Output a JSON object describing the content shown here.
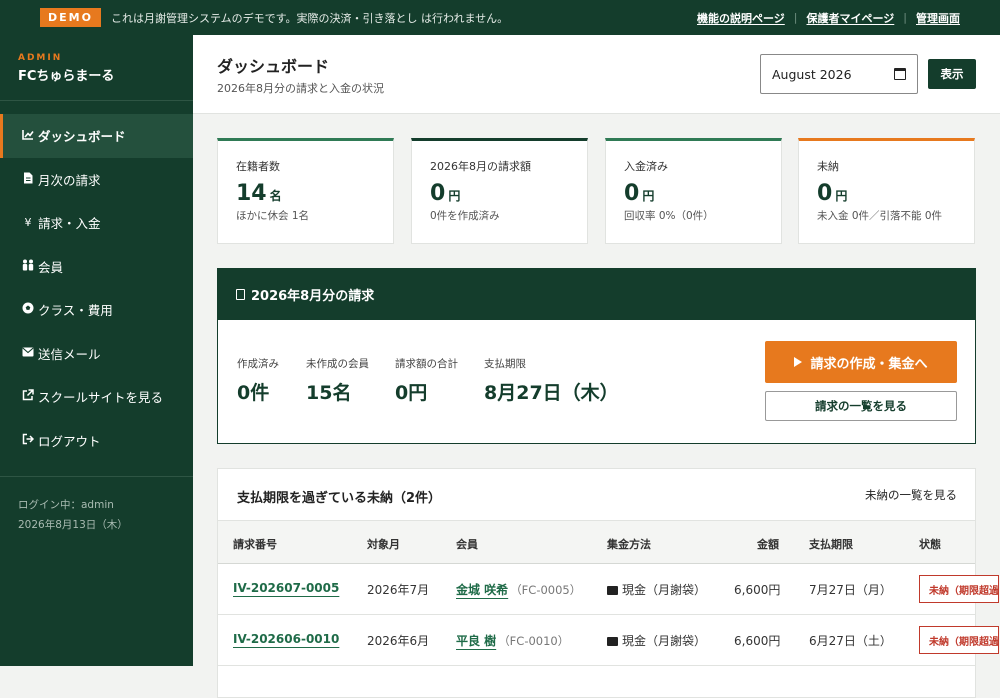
{
  "topbar": {
    "demo_badge": "DEMO",
    "demo_text": "これは月謝管理システムのデモです。実際の決済・引き落とし は行われません。",
    "links": [
      "機能の説明ページ",
      "保護者マイページ",
      "管理画面"
    ]
  },
  "sidebar": {
    "admin_label": "ADMIN",
    "brand": "FCちゅらまーる",
    "items": [
      {
        "label": "ダッシュボード",
        "icon": "chart-icon",
        "active": true
      },
      {
        "label": "月次の請求",
        "icon": "document-icon"
      },
      {
        "label": "請求・入金",
        "icon": "yen-icon"
      },
      {
        "label": "会員",
        "icon": "users-icon"
      },
      {
        "label": "クラス・費用",
        "icon": "soccer-ball-icon"
      },
      {
        "label": "送信メール",
        "icon": "mail-icon"
      },
      {
        "label": "スクールサイトを見る",
        "icon": "external-link-icon"
      },
      {
        "label": "ログアウト",
        "icon": "logout-icon"
      }
    ],
    "login_user": "ログイン中：admin",
    "date": "2026年8月13日（木）"
  },
  "header": {
    "title": "ダッシュボード",
    "subtitle": "2026年8月分の請求と入金の状況",
    "month_value": "August 2026",
    "show_button": "表示"
  },
  "cards": [
    {
      "label": "在籍者数",
      "value": "14",
      "unit": "名",
      "note": "ほかに休会 1名",
      "accent": "#2f7a55"
    },
    {
      "label": "2026年8月の請求額",
      "value": "0",
      "unit": "円",
      "note": "0件を作成済み",
      "accent": "#143d2c"
    },
    {
      "label": "入金済み",
      "value": "0",
      "unit": "円",
      "note": "回収率 0%（0件）",
      "accent": "#2f7a55"
    },
    {
      "label": "未納",
      "value": "0",
      "unit": "円",
      "note": "未入金 0件／引落不能 0件",
      "accent": "#e7791e"
    }
  ],
  "billing": {
    "title": "2026年8月分の請求",
    "stats": [
      {
        "label": "作成済み",
        "value": "0件"
      },
      {
        "label": "未作成の会員",
        "value": "15名"
      },
      {
        "label": "請求額の合計",
        "value": "0円"
      },
      {
        "label": "支払期限",
        "value": "8月27日（木）"
      }
    ],
    "primary_button": "請求の作成・集金へ",
    "secondary_button": "請求の一覧を見る"
  },
  "overdue": {
    "title": "支払期限を過ぎている未納（2件）",
    "link": "未納の一覧を見る",
    "columns": [
      "請求番号",
      "対象月",
      "会員",
      "集金方法",
      "金額",
      "支払期限",
      "状態"
    ],
    "rows": [
      {
        "invoice": "IV-202607-0005",
        "month": "2026年7月",
        "member": "金城 咲希",
        "member_code": "（FC-0005）",
        "method": "現金（月謝袋）",
        "amount": "6,600円",
        "due": "7月27日（月）",
        "status": "未納（期限超過）"
      },
      {
        "invoice": "IV-202606-0010",
        "month": "2026年6月",
        "member": "平良 樹",
        "member_code": "（FC-0010）",
        "method": "現金（月謝袋）",
        "amount": "6,600円",
        "due": "6月27日（土）",
        "status": "未納（期限超過）"
      }
    ]
  },
  "colors": {
    "brand_green": "#143d2c",
    "accent_orange": "#e7791e",
    "link_green": "#1f6b48",
    "alert_red": "#c0392b"
  }
}
